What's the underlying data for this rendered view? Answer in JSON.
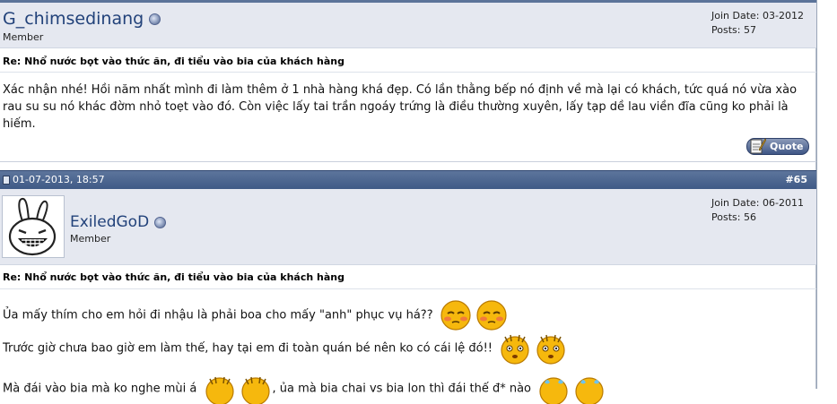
{
  "post1": {
    "username": "G_chimsedinang",
    "user_title": "Member",
    "join_date": "Join Date: 03-2012",
    "posts": "Posts: 57",
    "title": "Re: Nhổ nước bọt vào thức ăn, đi tiểu vào bia của khách hàng",
    "message": "Xác nhận nhé! Hồi năm nhất mình đi làm thêm ở 1 nhà hàng khá đẹp. Có lần thằng bếp nó định về mà lại có khách, tức quá nó vừa xào rau su su nó khác đờm nhỏ toẹt vào đó. Còn việc lấy tai trần ngoáy trứng là điều thường xuyên, lấy tạp dề lau viền đĩa cũng ko phải là hiếm.",
    "quote_label": "Quote"
  },
  "post2": {
    "date": "01-07-2013, 18:57",
    "post_number": "#65",
    "username": "ExiledGoD",
    "user_title": "Member",
    "join_date": "Join Date: 06-2011",
    "posts": "Posts: 56",
    "title": "Re: Nhổ nước bọt vào thức ăn, đi tiểu vào bia của khách hàng",
    "line1": "Ủa mấy thím cho em hỏi đi nhậu là phải boa cho mấy \"anh\" phục vụ há??",
    "line2": "Trước giờ chưa bao giờ em làm thế, hay tại em đi toàn quán bé nên ko có cái lệ đó!!",
    "line3a": "Mà đái vào bia mà ko nghe mùi á",
    "line3b": ", ủa mà bia chai vs bia lon thì đái thế đ* nào"
  },
  "icons": [
    "status-offline-icon",
    "quote-icon",
    "post-document-icon",
    "avatar-rabbit-icon",
    "smiley-blush-icon",
    "smiley-sweat-icon"
  ],
  "colors": {
    "header_bar": "#4a6590",
    "user_bar": "#e5e8f0",
    "username": "#22427a",
    "smiley_yellow": "#f5b80a"
  }
}
